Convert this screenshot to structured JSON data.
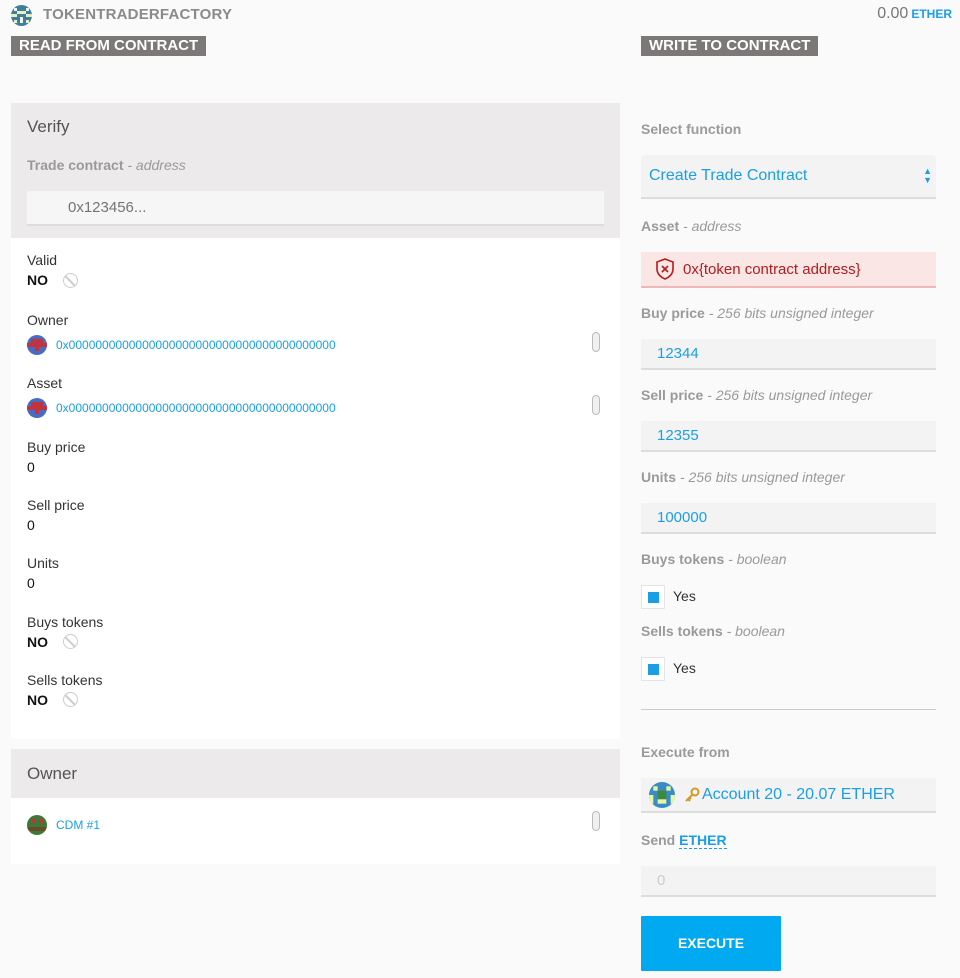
{
  "header": {
    "title": "TOKENTRADERFACTORY",
    "balance": "0.00",
    "balance_unit": "ETHER"
  },
  "read": {
    "tag": "READ FROM CONTRACT",
    "verify": {
      "title": "Verify",
      "input_label": "Trade contract",
      "input_type": "- address",
      "input_placeholder": "0x123456..."
    },
    "fields": {
      "valid_label": "Valid",
      "valid_value": "NO",
      "owner_label": "Owner",
      "owner_value": "0x0000000000000000000000000000000000000000",
      "asset_label": "Asset",
      "asset_value": "0x0000000000000000000000000000000000000000",
      "buy_price_label": "Buy price",
      "buy_price_value": "0",
      "sell_price_label": "Sell price",
      "sell_price_value": "0",
      "units_label": "Units",
      "units_value": "0",
      "buys_tokens_label": "Buys tokens",
      "buys_tokens_value": "NO",
      "sells_tokens_label": "Sells tokens",
      "sells_tokens_value": "NO"
    },
    "owner_section": {
      "title": "Owner",
      "value": "CDM #1"
    }
  },
  "write": {
    "tag": "WRITE TO CONTRACT",
    "select_function_label": "Select function",
    "selected_function": "Create Trade Contract",
    "asset_label": "Asset",
    "asset_type": "- address",
    "asset_placeholder": "0x{token contract address}",
    "buy_price_label": "Buy price",
    "buy_price_type": "- 256 bits unsigned integer",
    "buy_price_value": "12344",
    "sell_price_label": "Sell price",
    "sell_price_type": "- 256 bits unsigned integer",
    "sell_price_value": "12355",
    "units_label": "Units",
    "units_type": "- 256 bits unsigned integer",
    "units_value": "100000",
    "buys_tokens_label": "Buys tokens",
    "buys_tokens_type": "- boolean",
    "buys_tokens_check": "Yes",
    "sells_tokens_label": "Sells tokens",
    "sells_tokens_type": "- boolean",
    "sells_tokens_check": "Yes",
    "execute_from_label": "Execute from",
    "account": "Account 20 - 20.07 ETHER",
    "send_label": "Send",
    "send_unit": "ETHER",
    "send_placeholder": "0",
    "execute_label": "EXECUTE"
  },
  "colors": {
    "accent": "#1a9fe6",
    "tag_bg": "#7d7878",
    "error_bg": "#fbe6e6",
    "error_text": "#b31c1c",
    "execute_bg": "#00a9f0"
  }
}
